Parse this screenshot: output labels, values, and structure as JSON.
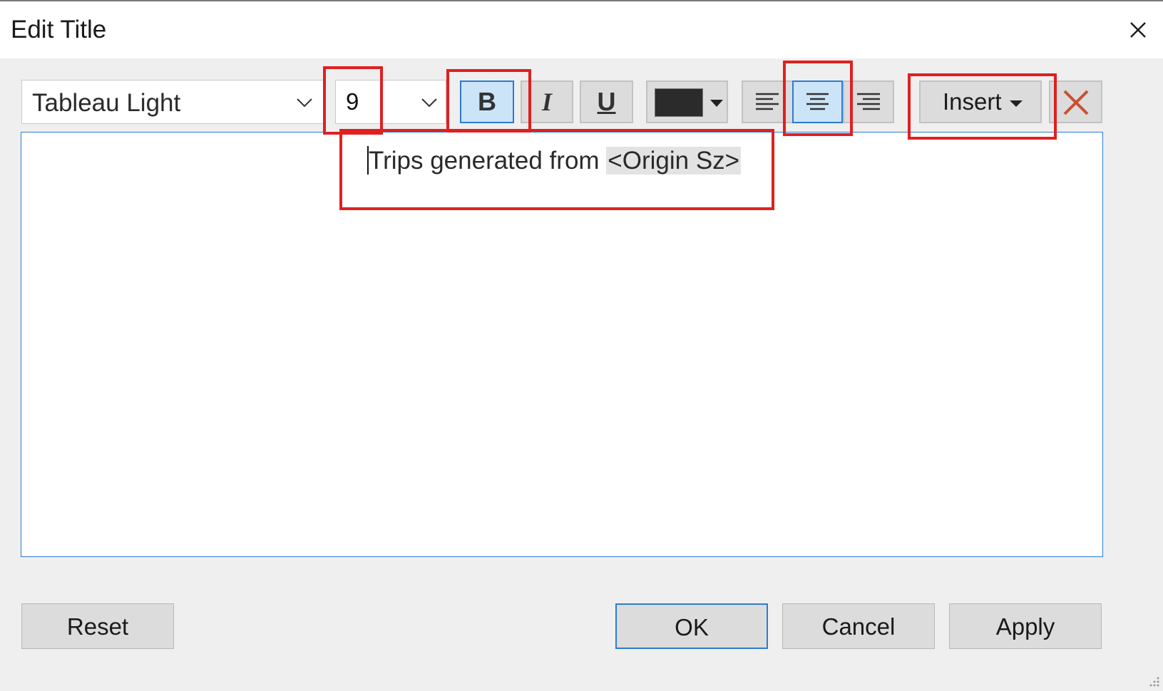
{
  "dialog": {
    "title": "Edit Title"
  },
  "toolbar": {
    "font_family": "Tableau Light",
    "font_size": "9",
    "bold_label": "B",
    "italic_label": "I",
    "underline_label": "U",
    "text_color": "#2b2b2b",
    "insert_label": "Insert",
    "icons": {
      "font_dropdown": "chevron-down-icon",
      "size_dropdown": "chevron-down-icon",
      "align_left": "align-left-icon",
      "align_center": "align-center-icon",
      "align_right": "align-right-icon",
      "clear": "close-x-icon"
    },
    "bold_active": true,
    "alignment": "center"
  },
  "editor": {
    "text_before_field": "Trips generated from ",
    "field_token": "<Origin Sz>"
  },
  "footer": {
    "reset_label": "Reset",
    "ok_label": "OK",
    "cancel_label": "Cancel",
    "apply_label": "Apply"
  },
  "colors": {
    "annotation_red": "#e02020",
    "active_blue": "#2b7cd3",
    "active_fill": "#cce4f7",
    "clear_icon": "#c9512f"
  }
}
